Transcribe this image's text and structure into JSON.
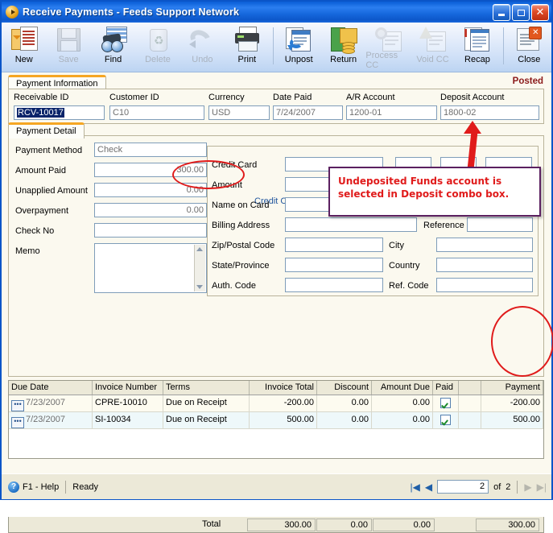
{
  "window": {
    "title": "Receive Payments - Feeds Support Network",
    "icon": "app-icon",
    "buttons": {
      "minimize": "_",
      "maximize": "□",
      "close": "✕"
    }
  },
  "toolbar": {
    "items": [
      {
        "label": "New",
        "icon": "new-document-icon",
        "enabled": true
      },
      {
        "label": "Save",
        "icon": "save-floppy-icon",
        "enabled": false
      },
      {
        "label": "Find",
        "icon": "find-binoculars-icon",
        "enabled": true
      },
      {
        "label": "Delete",
        "icon": "delete-recycle-icon",
        "enabled": false
      },
      {
        "label": "Undo",
        "icon": "undo-arrow-icon",
        "enabled": false
      },
      {
        "label": "Print",
        "icon": "print-printer-icon",
        "enabled": true
      },
      {
        "label": "Unpost",
        "icon": "unpost-icon",
        "enabled": true
      },
      {
        "label": "Return",
        "icon": "return-money-icon",
        "enabled": true
      },
      {
        "label": "Process CC",
        "icon": "process-cc-gear-icon",
        "enabled": false
      },
      {
        "label": "Void CC",
        "icon": "void-cc-warning-icon",
        "enabled": false
      },
      {
        "label": "Recap",
        "icon": "recap-pages-icon",
        "enabled": true
      },
      {
        "label": "Close",
        "icon": "close-window-icon",
        "enabled": true
      }
    ]
  },
  "main": {
    "tab_payment_information": "Payment Information",
    "status_label": "Posted",
    "header_fields": [
      {
        "label": "Receivable ID",
        "value": "RCV-10017",
        "selected": true
      },
      {
        "label": "Customer ID",
        "value": "C10",
        "selected": false
      },
      {
        "label": "Currency",
        "value": "USD",
        "selected": false
      },
      {
        "label": "Date Paid",
        "value": "7/24/2007",
        "selected": false
      },
      {
        "label": "A/R Account",
        "value": "1200-01",
        "selected": false
      },
      {
        "label": "Deposit Account",
        "value": "1800-02",
        "selected": false
      }
    ],
    "tab_payment_detail": "Payment Detail",
    "left_fields": [
      {
        "label": "Payment Method",
        "value": "Check"
      },
      {
        "label": "Amount Paid",
        "value": "300.00"
      },
      {
        "label": "Unapplied Amount",
        "value": "0.00"
      },
      {
        "label": "Overpayment",
        "value": "0.00"
      },
      {
        "label": "Check No",
        "value": ""
      },
      {
        "label": "Memo",
        "value": ""
      }
    ],
    "credit_card_group_title": "Credit Card Payment Information",
    "cc_fields_left": [
      {
        "label": "Credit Card",
        "value": ""
      },
      {
        "label": "Amount",
        "value": ""
      },
      {
        "label": "Name on Card",
        "value": ""
      },
      {
        "label": "Billing Address",
        "value": ""
      },
      {
        "label": "Zip/Postal Code",
        "value": ""
      },
      {
        "label": "State/Province",
        "value": ""
      },
      {
        "label": "Auth. Code",
        "value": ""
      }
    ],
    "cc_fields_right": [
      {
        "label": "Reference",
        "value": ""
      },
      {
        "label": "City",
        "value": ""
      },
      {
        "label": "Country",
        "value": ""
      },
      {
        "label": "Ref. Code",
        "value": ""
      }
    ]
  },
  "grid": {
    "columns": [
      "Due Date",
      "Invoice Number",
      "Terms",
      "Invoice Total",
      "Discount",
      "Amount Due",
      "Paid",
      "",
      "Payment"
    ],
    "rows": [
      {
        "due_date": "7/23/2007",
        "invoice_number": "CPRE-10010",
        "terms": "Due on Receipt",
        "invoice_total": "-200.00",
        "discount": "0.00",
        "amount_due": "0.00",
        "paid": true,
        "blank": "",
        "payment": "-200.00"
      },
      {
        "due_date": "7/23/2007",
        "invoice_number": "SI-10034",
        "terms": "Due on Receipt",
        "invoice_total": "500.00",
        "discount": "0.00",
        "amount_due": "0.00",
        "paid": true,
        "blank": "",
        "payment": "500.00"
      }
    ],
    "totals": {
      "label": "Total",
      "invoice_total": "300.00",
      "discount": "0.00",
      "amount_due": "0.00",
      "payment": "300.00"
    }
  },
  "statusbar": {
    "help": "F1 - Help",
    "state": "Ready",
    "page_current": "2",
    "of_label": "of",
    "page_total": "2"
  },
  "annotations": {
    "callout_line1": "Undeposited Funds account is",
    "callout_line2": "selected in Deposit combo box.",
    "callout_border_color": "#5b2060",
    "callout_text_color": "#e01b1b",
    "highlight_color": "#e01b1b",
    "arrow_color": "#e01b1b"
  }
}
